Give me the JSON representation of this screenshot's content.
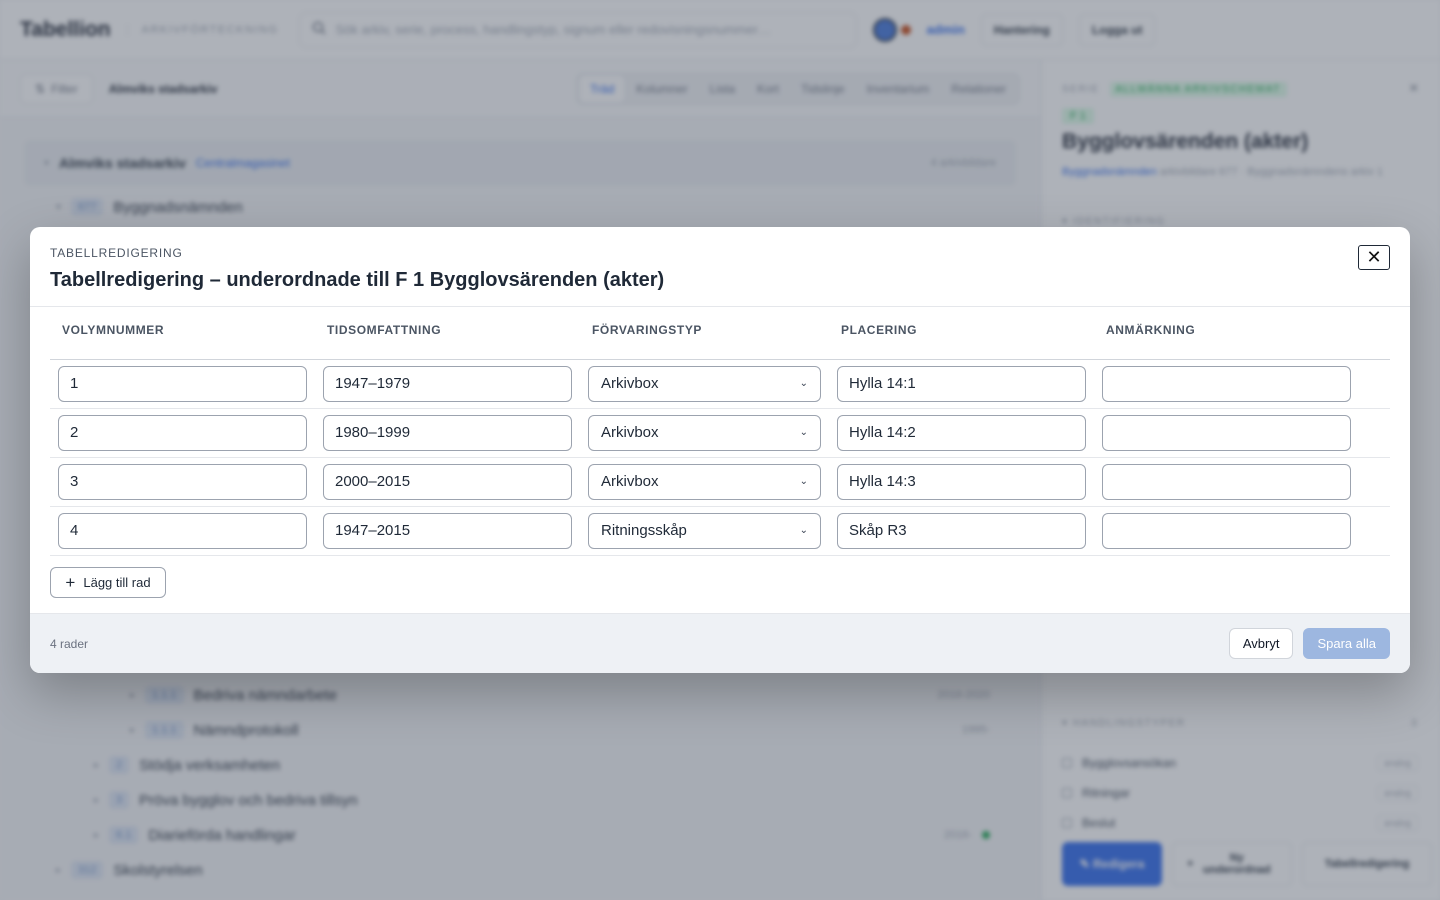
{
  "app": {
    "brand": "Tabellion",
    "brand_sub": "ARKIVFÖRTECKNING",
    "search_placeholder": "Sök arkiv, serie, process, handlingstyp, signum eller redovisningsnummer…",
    "user": "admin",
    "header_buttons": [
      "Hantering",
      "Logga ut"
    ],
    "filter_label": "Filter",
    "breadcrumb": "Almviks stadsarkiv",
    "views": [
      "Träd",
      "Kolumner",
      "Lista",
      "Kort",
      "Tidslinje",
      "Inventarium",
      "Relationer"
    ],
    "active_view": "Träd",
    "tree": {
      "root": {
        "label": "Almviks stadsarkiv",
        "link": "Centralmagasinet",
        "meta": "4 arkivbildare"
      },
      "items": [
        {
          "code": "677",
          "label": "Byggnadsnämnden",
          "meta": ""
        },
        {
          "code": "1.1.1",
          "label": "Bedriva nämndarbete",
          "meta": "2016-2020"
        },
        {
          "code": "1.1.1",
          "label": "Nämndprotokoll",
          "meta": "1995-"
        },
        {
          "code": "2",
          "label": "Stödja verksamheten",
          "meta": ""
        },
        {
          "code": "3",
          "label": "Pröva bygglov och bedriva tillsyn",
          "meta": ""
        },
        {
          "code": "6.1",
          "label": "Diarieförda handlingar",
          "meta": "2016-"
        },
        {
          "code": "312",
          "label": "Skolstyrelsen",
          "meta": ""
        }
      ]
    },
    "detail": {
      "kicker": "SERIE",
      "badge": "ALLMÄNNA ARKIVSCHEMAT",
      "code": "F 1",
      "title": "Bygglovsärenden (akter)",
      "sub_link": "Byggnadsnämnden",
      "sub_text": "arkivbildare 677 · Byggnadsnämndens arkiv 1",
      "section_ident": "IDENTIFIERING",
      "section_types": "HANDLINGSTYPER",
      "section_types_count": "3",
      "types": [
        {
          "label": "Bygglovsansökan",
          "tag": "analog"
        },
        {
          "label": "Ritningar",
          "tag": "analog"
        },
        {
          "label": "Beslut",
          "tag": "analog"
        }
      ],
      "actions": {
        "primary": "Redigera",
        "new_child": "Ny underordnad",
        "table_edit": "Tabellredigering"
      }
    }
  },
  "modal": {
    "kicker": "TABELLREDIGERING",
    "title": "Tabellredigering – underordnade till F 1 Bygglovsärenden (akter)",
    "close_icon": "close-icon",
    "columns": [
      "VOLYMNUMMER",
      "TIDSOMFATTNING",
      "FÖRVARINGSTYP",
      "PLACERING",
      "ANMÄRKNING"
    ],
    "rows": [
      {
        "volym": "1",
        "tid": "1947–1979",
        "typ": "Arkivbox",
        "placering": "Hylla 14:1",
        "anm": ""
      },
      {
        "volym": "2",
        "tid": "1980–1999",
        "typ": "Arkivbox",
        "placering": "Hylla 14:2",
        "anm": ""
      },
      {
        "volym": "3",
        "tid": "2000–2015",
        "typ": "Arkivbox",
        "placering": "Hylla 14:3",
        "anm": ""
      },
      {
        "volym": "4",
        "tid": "1947–2015",
        "typ": "Ritningsskåp",
        "placering": "Skåp R3",
        "anm": ""
      }
    ],
    "add_row": "Lägg till rad",
    "row_count": "4 rader",
    "cancel": "Avbryt",
    "save_all": "Spara alla"
  },
  "colors": {
    "accent": "#2563eb",
    "save_disabled": "#9db7e0",
    "badge_green": "#16a34a"
  }
}
